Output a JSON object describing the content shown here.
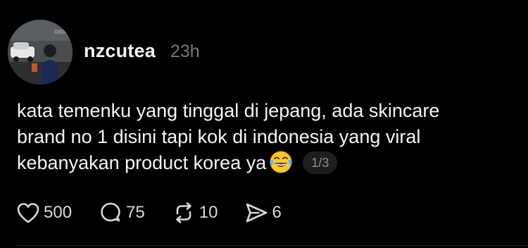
{
  "post": {
    "username": "nzcutea",
    "timestamp": "23h",
    "text_lines": [
      "kata temenku yang tinggal di jepang, ada skincare",
      "brand no 1 disini tapi kok di indonesia yang viral",
      "kebanyakan product korea ya"
    ],
    "emoji": "tears-of-joy-emoji",
    "page_indicator": "1/3"
  },
  "actions": {
    "likes": "500",
    "replies": "75",
    "reposts": "10",
    "shares": "6"
  },
  "icons": {
    "like": "heart-icon",
    "reply": "comment-bubble-icon",
    "repost": "repost-icon",
    "share": "send-icon"
  },
  "colors": {
    "background": "#000000",
    "primary_text": "#f3f5f7",
    "secondary_text": "#777777",
    "badge_bg": "#1e1e1e"
  }
}
